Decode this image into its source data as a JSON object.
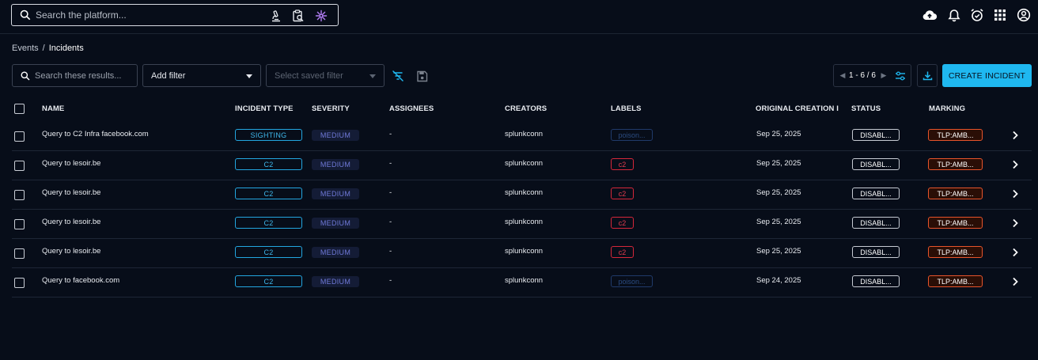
{
  "topbar": {
    "search_placeholder": "Search the platform...",
    "icons": [
      "search-icon",
      "microscope-icon",
      "clipboard-search-icon",
      "ai-sparkle-icon",
      "cloud-upload-icon",
      "bell-icon",
      "alarm-clock-icon",
      "apps-grid-icon",
      "account-circle-icon"
    ]
  },
  "breadcrumb": {
    "parent": "Events",
    "separator": "/",
    "current": "Incidents"
  },
  "toolbar": {
    "search_placeholder": "Search these results...",
    "add_filter": "Add filter",
    "saved_filter_placeholder": "Select saved filter",
    "pagination": "1 - 6 / 6",
    "create_label": "CREATE INCIDENT"
  },
  "table": {
    "headers": {
      "name": "NAME",
      "incident_type": "INCIDENT TYPE",
      "severity": "SEVERITY",
      "assignees": "ASSIGNEES",
      "creators": "CREATORS",
      "labels": "LABELS",
      "original_creation": "ORIGINAL CREATION I",
      "status": "STATUS",
      "marking": "MARKING"
    },
    "rows": [
      {
        "name": "Query to C2 Infra facebook.com",
        "type": "SIGHTING",
        "severity": "MEDIUM",
        "assignees": "-",
        "creator": "splunkconn",
        "label": "poison...",
        "label_kind": "poison",
        "date": "Sep 25, 2025",
        "status": "DISABL...",
        "marking": "TLP:AMB..."
      },
      {
        "name": "Query to lesoir.be",
        "type": "C2",
        "severity": "MEDIUM",
        "assignees": "-",
        "creator": "splunkconn",
        "label": "c2",
        "label_kind": "c2",
        "date": "Sep 25, 2025",
        "status": "DISABL...",
        "marking": "TLP:AMB..."
      },
      {
        "name": "Query to lesoir.be",
        "type": "C2",
        "severity": "MEDIUM",
        "assignees": "-",
        "creator": "splunkconn",
        "label": "c2",
        "label_kind": "c2",
        "date": "Sep 25, 2025",
        "status": "DISABL...",
        "marking": "TLP:AMB..."
      },
      {
        "name": "Query to lesoir.be",
        "type": "C2",
        "severity": "MEDIUM",
        "assignees": "-",
        "creator": "splunkconn",
        "label": "c2",
        "label_kind": "c2",
        "date": "Sep 25, 2025",
        "status": "DISABL...",
        "marking": "TLP:AMB..."
      },
      {
        "name": "Query to lesoir.be",
        "type": "C2",
        "severity": "MEDIUM",
        "assignees": "-",
        "creator": "splunkconn",
        "label": "c2",
        "label_kind": "c2",
        "date": "Sep 25, 2025",
        "status": "DISABL...",
        "marking": "TLP:AMB..."
      },
      {
        "name": "Query to facebook.com",
        "type": "C2",
        "severity": "MEDIUM",
        "assignees": "-",
        "creator": "splunkconn",
        "label": "poison...",
        "label_kind": "poison",
        "date": "Sep 24, 2025",
        "status": "DISABL...",
        "marking": "TLP:AMB..."
      }
    ]
  },
  "colors": {
    "background": "#070d19",
    "accent": "#1fb8f0",
    "marking": "#e8542b",
    "label_c2": "#e23c4e"
  }
}
